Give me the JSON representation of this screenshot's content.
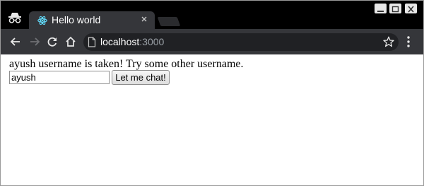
{
  "browser": {
    "tab": {
      "title": "Hello world",
      "favicon": "react-atom-icon"
    },
    "address_bar": {
      "host": "localhost",
      "port": ":3000"
    },
    "icons": {
      "incognito": "incognito-icon",
      "back": "back-arrow-icon",
      "forward": "forward-arrow-icon",
      "reload": "reload-icon",
      "home": "home-icon",
      "page_info": "page-info-icon",
      "bookmark": "star-icon",
      "menu": "kebab-menu-icon"
    },
    "colors": {
      "tab_strip": "#000000",
      "toolbar": "#35363a",
      "omnibox": "#202124",
      "favicon": "#61dafb"
    }
  },
  "page": {
    "message": "ayush username is taken! Try some other username.",
    "username_input": {
      "value": "ayush"
    },
    "submit_label": "Let me chat!"
  }
}
